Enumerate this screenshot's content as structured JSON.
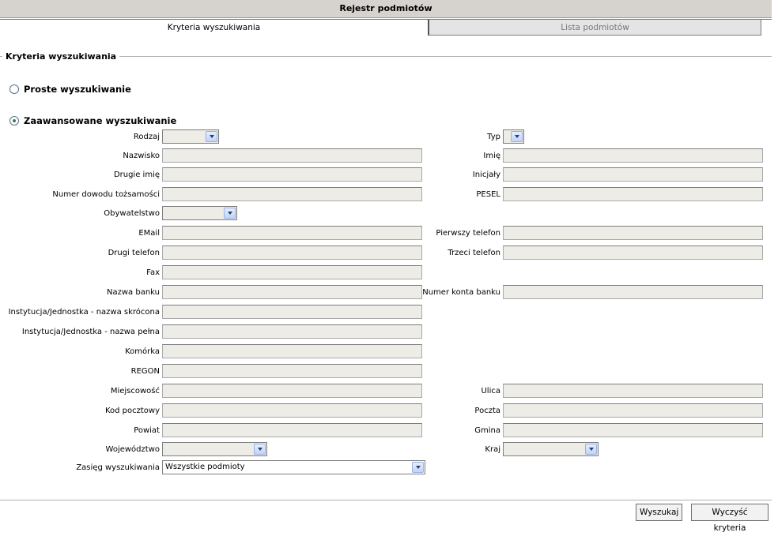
{
  "window": {
    "title": "Rejestr podmiotów"
  },
  "tabs": [
    {
      "label": "Kryteria wyszukiwania",
      "active": true
    },
    {
      "label": "Lista podmiotów",
      "active": false
    }
  ],
  "fieldset": {
    "legend": "Kryteria wyszukiwania"
  },
  "search_mode": {
    "simple": {
      "label": "Proste wyszukiwanie",
      "selected": false
    },
    "advanced": {
      "label": "Zaawansowane wyszukiwanie",
      "selected": true
    }
  },
  "fields": {
    "rodzaj": {
      "label": "Rodzaj",
      "value": ""
    },
    "typ": {
      "label": "Typ",
      "value": ""
    },
    "nazwisko": {
      "label": "Nazwisko",
      "value": ""
    },
    "imie": {
      "label": "Imię",
      "value": ""
    },
    "drugie_imie": {
      "label": "Drugie imię",
      "value": ""
    },
    "inicjaly": {
      "label": "Inicjały",
      "value": ""
    },
    "numer_dowodu": {
      "label": "Numer dowodu tożsamości",
      "value": ""
    },
    "pesel": {
      "label": "PESEL",
      "value": ""
    },
    "obywatelstwo": {
      "label": "Obywatelstwo",
      "value": ""
    },
    "email": {
      "label": "EMail",
      "value": ""
    },
    "pierwszy_telefon": {
      "label": "Pierwszy telefon",
      "value": ""
    },
    "drugi_telefon": {
      "label": "Drugi telefon",
      "value": ""
    },
    "trzeci_telefon": {
      "label": "Trzeci telefon",
      "value": ""
    },
    "fax": {
      "label": "Fax",
      "value": ""
    },
    "nazwa_banku": {
      "label": "Nazwa banku",
      "value": ""
    },
    "numer_konta": {
      "label": "Numer konta banku",
      "value": ""
    },
    "instytucja_skrocona": {
      "label": "Instytucja/Jednostka - nazwa skrócona",
      "value": ""
    },
    "instytucja_pelna": {
      "label": "Instytucja/Jednostka - nazwa pełna",
      "value": ""
    },
    "komorka": {
      "label": "Komórka",
      "value": ""
    },
    "regon": {
      "label": "REGON",
      "value": ""
    },
    "miejscowosc": {
      "label": "Miejscowość",
      "value": ""
    },
    "ulica": {
      "label": "Ulica",
      "value": ""
    },
    "kod_pocztowy": {
      "label": "Kod pocztowy",
      "value": ""
    },
    "poczta": {
      "label": "Poczta",
      "value": ""
    },
    "powiat": {
      "label": "Powiat",
      "value": ""
    },
    "gmina": {
      "label": "Gmina",
      "value": ""
    },
    "wojewodztwo": {
      "label": "Województwo",
      "value": ""
    },
    "kraj": {
      "label": "Kraj",
      "value": ""
    },
    "zasieg": {
      "label": "Zasięg wyszukiwania",
      "value": "Wszystkie podmioty"
    }
  },
  "buttons": {
    "search": "Wyszukaj",
    "clear": "Wyczyść kryteria"
  }
}
